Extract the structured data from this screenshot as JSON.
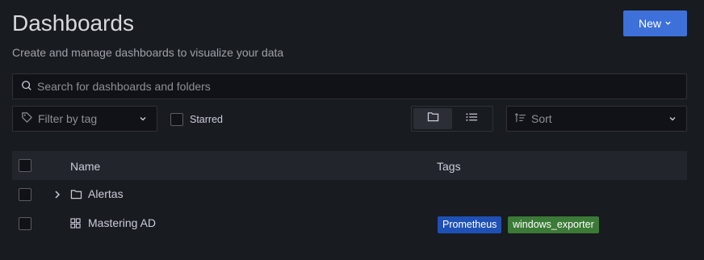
{
  "header": {
    "title": "Dashboards",
    "subtitle": "Create and manage dashboards to visualize your data",
    "new_button_label": "New"
  },
  "search": {
    "placeholder": "Search for dashboards and folders"
  },
  "filters": {
    "tag_filter_placeholder": "Filter by tag",
    "starred_label": "Starred",
    "starred_checked": false,
    "view_mode": "folders",
    "sort_label": "Sort"
  },
  "table": {
    "columns": [
      "Name",
      "Tags"
    ],
    "rows": [
      {
        "type": "folder",
        "name": "Alertas",
        "tags": []
      },
      {
        "type": "dashboard",
        "name": "Mastering AD",
        "tags": [
          {
            "label": "Prometheus",
            "color": "#1f50b5"
          },
          {
            "label": "windows_exporter",
            "color": "#3b7a37"
          }
        ]
      }
    ]
  },
  "colors": {
    "background": "#181b1f",
    "primary": "#3d71d9"
  }
}
